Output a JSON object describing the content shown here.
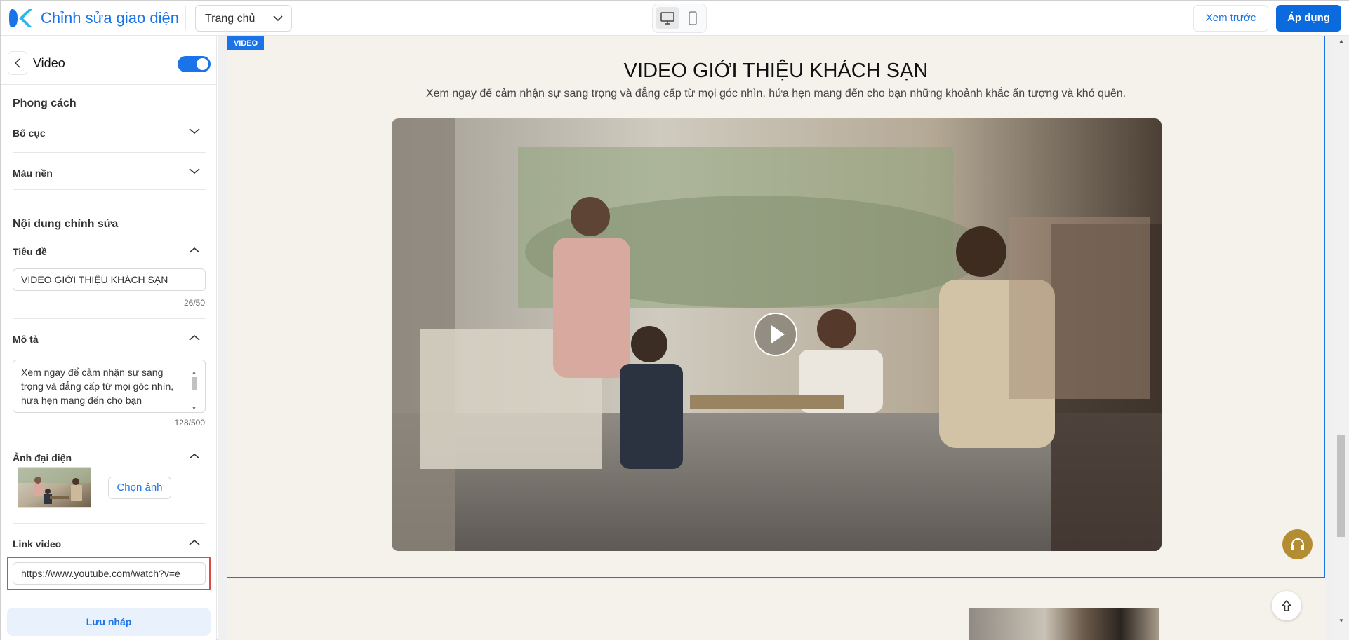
{
  "app": {
    "title": "Chỉnh sửa giao diện"
  },
  "topbar": {
    "page_select": "Trang chủ",
    "preview_label": "Xem trước",
    "apply_label": "Áp dụng"
  },
  "sidebar": {
    "title": "Video",
    "toggle_on": true,
    "style_heading": "Phong cách",
    "layout_label": "Bố cục",
    "background_label": "Màu nền",
    "content_heading": "Nội dung chỉnh sửa",
    "title_field": {
      "label": "Tiêu đề",
      "value": "VIDEO GIỚI THIỆU KHÁCH SẠN",
      "counter": "26/50"
    },
    "description_field": {
      "label": "Mô tả",
      "value": "Xem ngay để cảm nhận sự sang trọng và đẳng cấp từ mọi góc nhìn, hứa hẹn mang đến cho bạn",
      "counter": "128/500"
    },
    "avatar_field": {
      "label": "Ảnh đại diện",
      "choose_label": "Chọn ảnh"
    },
    "link_field": {
      "label": "Link video",
      "value": "https://www.youtube.com/watch?v=e"
    },
    "save_label": "Lưu nháp"
  },
  "canvas": {
    "section_tag": "VIDEO",
    "video_title": "VIDEO GIỚI THIỆU KHÁCH SẠN",
    "video_description": "Xem ngay để cảm nhận sự sang trọng và đẳng cấp từ mọi góc nhìn, hứa hẹn mang đến cho bạn những khoảnh khắc ấn tượng và khó quên."
  },
  "colors": {
    "accent": "#1a73e8",
    "apply_button": "#0b6bde",
    "highlight": "#e04848",
    "support_button": "#b48d33",
    "section_bg": "#f4f2eb"
  }
}
